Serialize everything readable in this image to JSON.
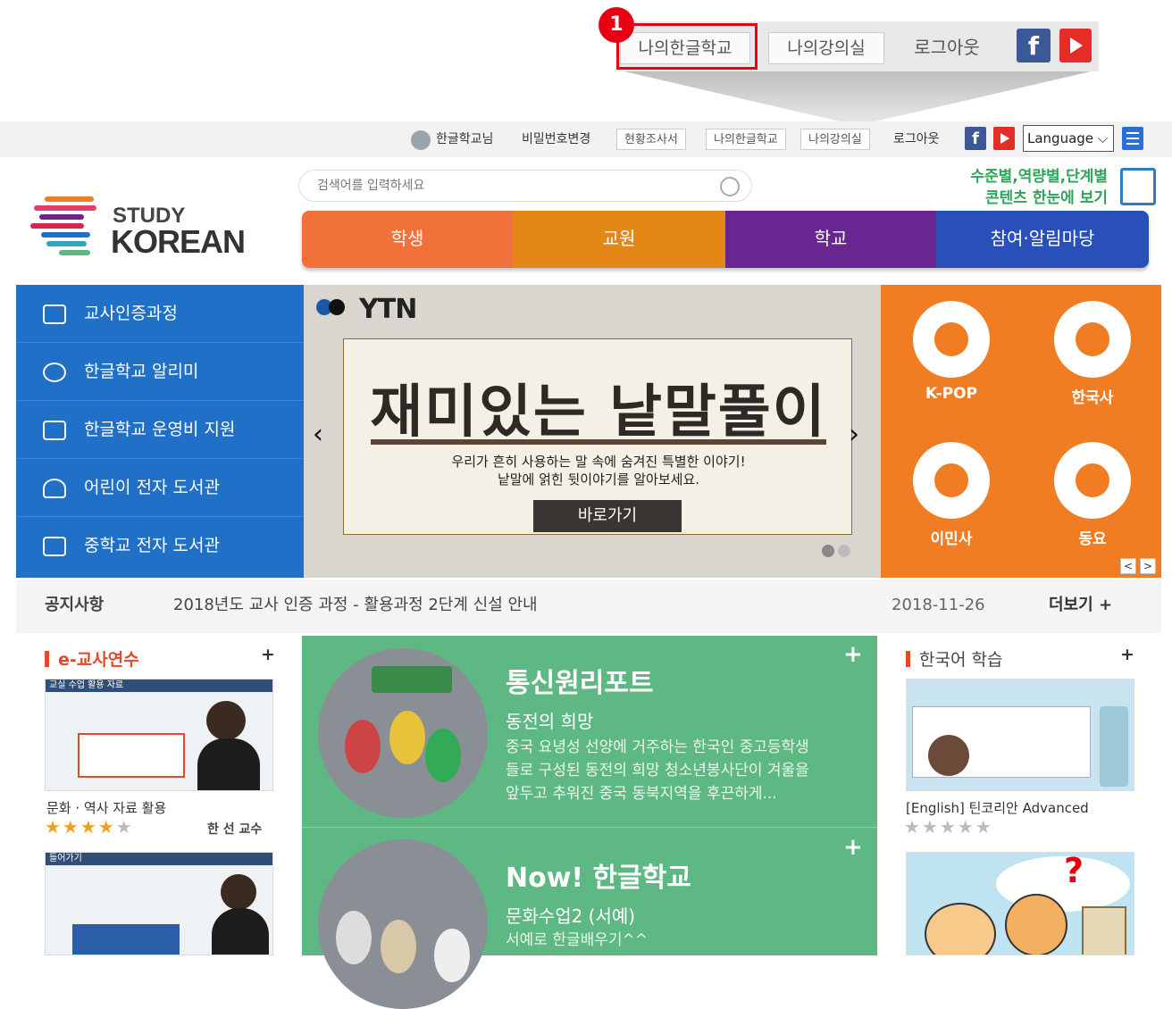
{
  "callout": {
    "badge": "1",
    "my_school": "나의한글학교",
    "my_classroom": "나의강의실",
    "logout": "로그아웃",
    "facebook": "f"
  },
  "topbar": {
    "username": "한글학교님",
    "change_password": "비밀번호변경",
    "status_survey": "현황조사서",
    "my_school": "나의한글학교",
    "my_classroom": "나의강의실",
    "logout": "로그아웃",
    "facebook": "f",
    "language": "Language ⌵"
  },
  "header": {
    "logo_line1": "STUDY",
    "logo_line2": "KOREAN",
    "search_placeholder": "검색어를 입력하세요",
    "promo_line1": "수준별,역량별,단계별",
    "promo_line2": "콘텐츠 한눈에 보기"
  },
  "nav": {
    "tabs": [
      {
        "label": "학생",
        "color": "#f0723a"
      },
      {
        "label": "교원",
        "color": "#e38716"
      },
      {
        "label": "학교",
        "color": "#6a2690"
      },
      {
        "label": "참여·알림마당",
        "color": "#2950b8"
      }
    ]
  },
  "left_menu": {
    "items": [
      {
        "label": "교사인증과정"
      },
      {
        "label": "한글학교 알리미"
      },
      {
        "label": "한글학교 운영비 지원"
      },
      {
        "label": "어린이 전자 도서관"
      },
      {
        "label": "중학교 전자 도서관"
      }
    ]
  },
  "banner": {
    "brand": "YTN",
    "title": "재미있는 낱말풀이",
    "subtitle1": "우리가 흔히 사용하는 말 속에 숨겨진 특별한 이야기!",
    "subtitle2": "낱말에 얽힌 뒷이야기를 알아보세요.",
    "go_button": "바로가기",
    "prev": "‹",
    "next": "›"
  },
  "right_panel": {
    "items": [
      {
        "label": "K-POP"
      },
      {
        "label": "한국사"
      },
      {
        "label": "이민사"
      },
      {
        "label": "동요"
      }
    ],
    "prev": "<",
    "next": ">",
    "accent": "#f07d23"
  },
  "notice": {
    "label": "공지사항",
    "text": "2018년도 교사 인증 과정 - 활용과정 2단계 신설 안내",
    "date": "2018-11-26",
    "more": "더보기 +"
  },
  "e_training": {
    "title": "e-교사연수",
    "plus": "+",
    "item1_title": "문화 · 역사 자료 활용",
    "item1_author": "한 선 교수",
    "item1_stars": "★★★★★",
    "item1_rating": 4,
    "video1_caption": "교실 수업 활용 자료",
    "video2_caption": "들어가기"
  },
  "green": {
    "block1_title": "통신원리포트",
    "block1_sub": "동전의 희망",
    "block1_text1": "중국 요녕성 선양에 거주하는 한국인 중고등학생",
    "block1_text2": "들로 구성된 동전의 희망 청소년봉사단이 겨울을",
    "block1_text3": "앞두고 추워진 중국 동북지역을 후끈하게...",
    "block2_title": "Now! 한글학교",
    "block2_sub": "문화수업2 (서예)",
    "block2_text1": "서예로 한글배우기^^",
    "plus": "+"
  },
  "korean_study": {
    "title": "한국어 학습",
    "plus": "+",
    "item1_title": "[English] 틴코리안 Advanced",
    "item1_stars": "★★★★★",
    "item1_rating": 0,
    "question": "?"
  },
  "colors": {
    "blue_menu": "#2070c8",
    "green_box": "#5eb883",
    "red_highlight": "#e60012",
    "star": "#f0a020"
  }
}
